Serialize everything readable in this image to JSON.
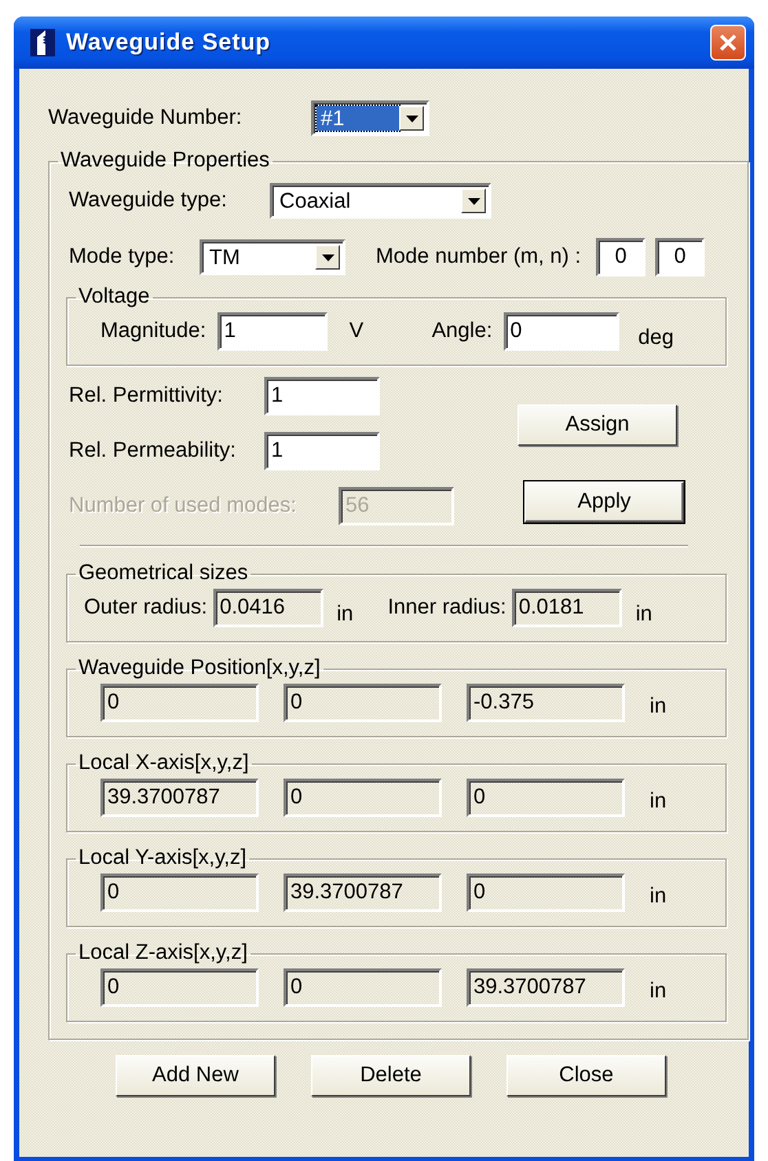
{
  "window": {
    "title": "Waveguide Setup"
  },
  "waveguide_number": {
    "label": "Waveguide Number:",
    "value": "#1",
    "focused": true
  },
  "properties": {
    "title": "Waveguide Properties",
    "waveguide_type": {
      "label": "Waveguide type:",
      "value": "Coaxial"
    },
    "mode_type": {
      "label": "Mode type:",
      "value": "TM"
    },
    "mode_number": {
      "label": "Mode number (m, n) :",
      "values": [
        "0",
        "0"
      ]
    },
    "voltage": {
      "title": "Voltage",
      "magnitude": {
        "label": "Magnitude:",
        "value": "1",
        "unit": "V"
      },
      "angle": {
        "label": "Angle:",
        "value": "0",
        "unit": "deg"
      }
    },
    "rel_permittivity": {
      "label": "Rel. Permittivity:",
      "value": "1"
    },
    "rel_permeability": {
      "label": "Rel. Permeability:",
      "value": "1"
    },
    "used_modes": {
      "label": "Number of used modes:",
      "value": "56",
      "disabled": true
    },
    "buttons": [
      {
        "label": "Assign",
        "default": false
      },
      {
        "label": "Apply",
        "default": true
      }
    ],
    "geometry": {
      "title": "Geometrical sizes",
      "fields": [
        {
          "label": "Outer radius:",
          "value": "0.0416",
          "unit": "in"
        },
        {
          "label": "Inner radius:",
          "value": "0.0181",
          "unit": "in"
        }
      ]
    },
    "vectors": [
      {
        "title": "Waveguide Position[x,y,z]",
        "values": [
          "0",
          "0",
          "-0.375"
        ],
        "unit": "in"
      },
      {
        "title": "Local X-axis[x,y,z]",
        "values": [
          "39.3700787",
          "0",
          "0"
        ],
        "unit": "in"
      },
      {
        "title": "Local Y-axis[x,y,z]",
        "values": [
          "0",
          "39.3700787",
          "0"
        ],
        "unit": "in"
      },
      {
        "title": "Local Z-axis[x,y,z]",
        "values": [
          "0",
          "0",
          "39.3700787"
        ],
        "unit": "in"
      }
    ]
  },
  "buttons": [
    "Add New",
    "Delete",
    "Close"
  ]
}
